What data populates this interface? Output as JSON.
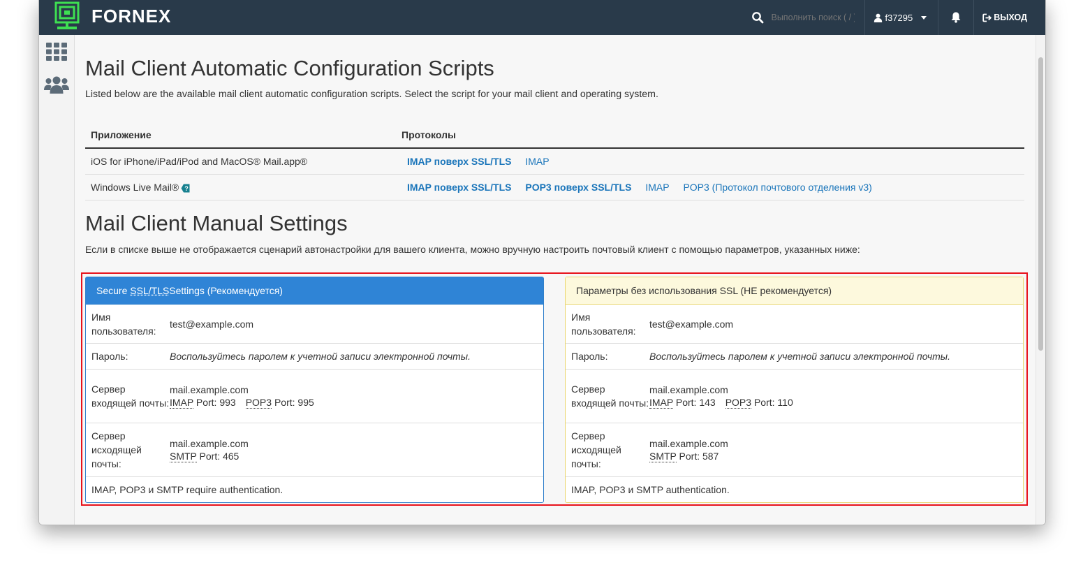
{
  "header": {
    "logo_text": "FORNEX",
    "search_placeholder": "Выполнить поиск ( / )",
    "username": "f37295",
    "logout_label": "ВЫХОД"
  },
  "sidebar": {
    "items": [
      {
        "icon": "grid-icon"
      },
      {
        "icon": "users-icon"
      }
    ]
  },
  "auto_config": {
    "title": "Mail Client Automatic Configuration Scripts",
    "description": "Listed below are the available mail client automatic configuration scripts. Select the script for your mail client and operating system.",
    "col_app": "Приложение",
    "col_protocols": "Протоколы",
    "rows": [
      {
        "app": "iOS for iPhone/iPad/iPod and MacOS® Mail.app®",
        "links": [
          "IMAP поверх SSL/TLS",
          "IMAP"
        ]
      },
      {
        "app": "Windows Live Mail®",
        "links": [
          "IMAP поверх SSL/TLS",
          "POP3 поверх SSL/TLS",
          "IMAP",
          "POP3 (Протокол почтового отделения v3)"
        ]
      }
    ]
  },
  "manual": {
    "title": "Mail Client Manual Settings",
    "description": "Если в списке выше не отображается сценарий автонастройки для вашего клиента, можно вручную настроить почтовый клиент с помощью параметров, указанных ниже:",
    "ssl": {
      "heading_pre": "Secure ",
      "heading_abbr": "SSL/TLS",
      "heading_post": " Settings (Рекомендуется)",
      "username_label": "Имя пользователя:",
      "username": "test@example.com",
      "password_label": "Пароль:",
      "password": "Воспользуйтесь паролем к учетной записи электронной почты.",
      "incoming_label": "Сервер входящей почты:",
      "incoming_host": "mail.example.com",
      "imap_abbr": "IMAP",
      "imap_port": "Port: 993",
      "pop3_abbr": "POP3",
      "pop3_port": "Port: 995",
      "outgoing_label": "Сервер исходящей почты:",
      "outgoing_host": "mail.example.com",
      "smtp_abbr": "SMTP",
      "smtp_port": "Port: 465",
      "footer": "IMAP, POP3 и SMTP require authentication."
    },
    "nossl": {
      "heading": "Параметры без использования SSL (НЕ рекомендуется)",
      "username_label": "Имя пользователя:",
      "username": "test@example.com",
      "password_label": "Пароль:",
      "password": "Воспользуйтесь паролем к учетной записи электронной почты.",
      "incoming_label": "Сервер входящей почты:",
      "incoming_host": "mail.example.com",
      "imap_abbr": "IMAP",
      "imap_port": "Port: 143",
      "pop3_abbr": "POP3",
      "pop3_port": "Port: 110",
      "outgoing_label": "Сервер исходящей почты:",
      "outgoing_host": "mail.example.com",
      "smtp_abbr": "SMTP",
      "smtp_port": "Port: 587",
      "footer": "IMAP, POP3 и SMTP authentication."
    }
  },
  "colors": {
    "topbar": "#293a4a",
    "logo_green": "#3ee052",
    "link_blue": "#1a75ba",
    "ssl_header": "#2f84d6",
    "nossl_header": "#fdf9dd",
    "highlight_red": "#e8121b"
  }
}
